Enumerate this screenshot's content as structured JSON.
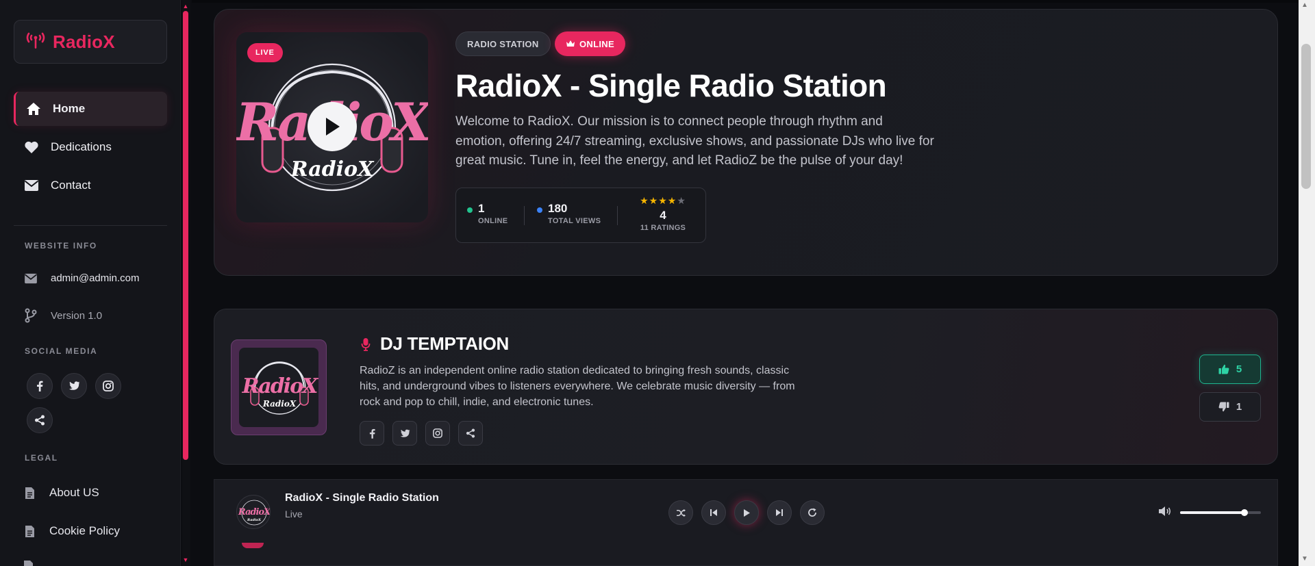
{
  "sidebar": {
    "logo": {
      "text": "RadioX",
      "icon": "radio-tower-icon"
    },
    "nav": [
      {
        "label": "Home",
        "icon": "home-icon",
        "active": true
      },
      {
        "label": "Dedications",
        "icon": "heart-icon",
        "active": false
      },
      {
        "label": "Contact",
        "icon": "envelope-icon",
        "active": false
      }
    ],
    "website_info": {
      "heading": "WEBSITE INFO",
      "email": "admin@admin.com",
      "version": "Version 1.0"
    },
    "social": {
      "heading": "SOCIAL MEDIA",
      "icons": [
        "facebook-icon",
        "twitter-icon",
        "instagram-icon",
        "share-icon"
      ]
    },
    "legal": {
      "heading": "LEGAL",
      "items": [
        "About US",
        "Cookie Policy"
      ]
    }
  },
  "hero": {
    "live_badge": "LIVE",
    "pill_station": "RADIO STATION",
    "pill_online": "ONLINE",
    "title": "RadioX - Single Radio Station",
    "description": "Welcome to RadioX. Our mission is to connect people through rhythm and emotion, offering 24/7 streaming, exclusive shows, and passionate DJs who live for great music. Tune in, feel the energy, and let RadioZ be the pulse of your day!",
    "stats": {
      "online_value": "1",
      "online_label": "ONLINE",
      "views_value": "180",
      "views_label": "TOTAL VIEWS",
      "rating_value": "4",
      "rating_stars": 4,
      "rating_label": "11 RATINGS"
    }
  },
  "dj": {
    "title": "DJ TEMPTAION",
    "description": "RadioZ is an independent online radio station dedicated to bringing fresh sounds, classic hits, and underground vibes to listeners everywhere. We celebrate music diversity — from rock and pop to chill, indie, and electronic tunes.",
    "likes": "5",
    "dislikes": "1"
  },
  "player": {
    "title": "RadioX - Single Radio Station",
    "subtitle": "Live",
    "volume": 0.8
  },
  "colors": {
    "accent": "#e8275f",
    "background": "#0c0d11",
    "sidebar": "#14151a",
    "card": "#1c1d23",
    "success": "#2ed3a5",
    "star": "#f5b400"
  }
}
